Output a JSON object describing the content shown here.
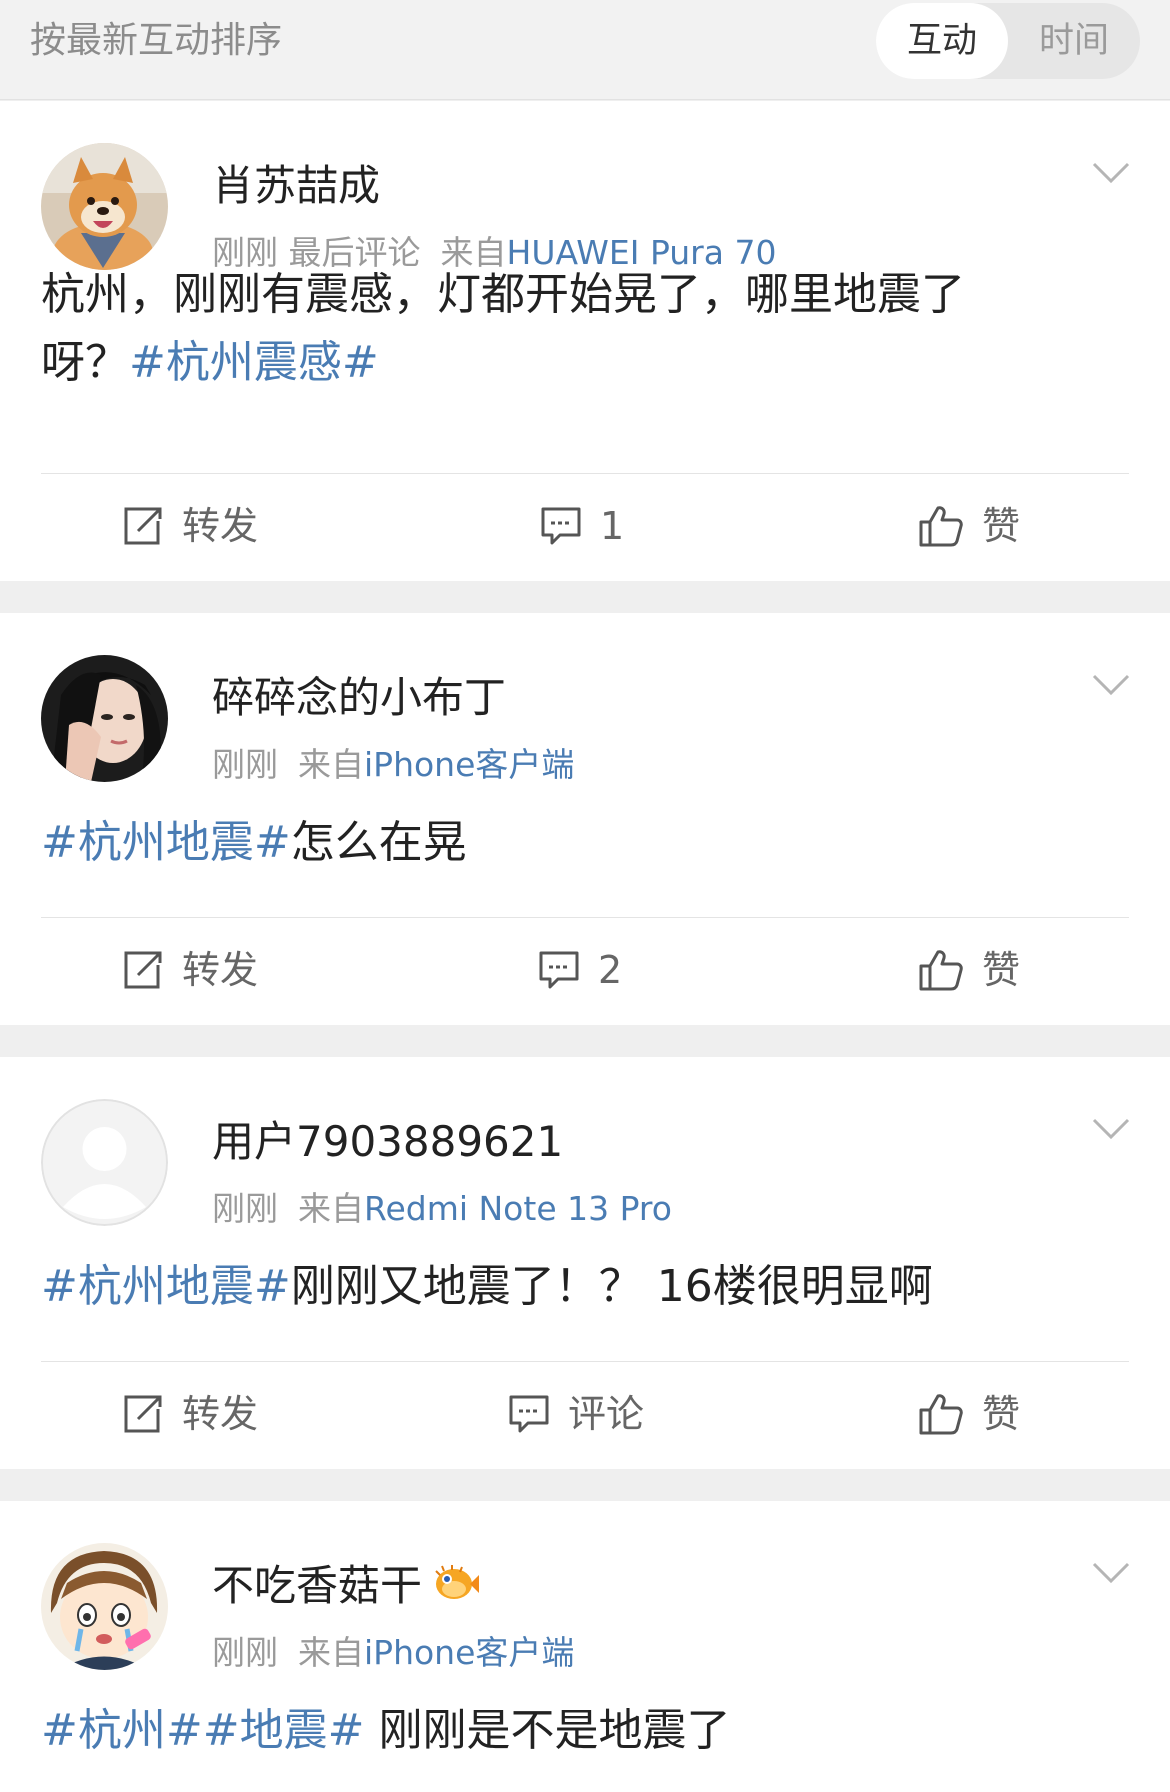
{
  "sort": {
    "title": "按最新互动排序",
    "tab_active": "互动",
    "tab_other": "时间"
  },
  "posts": [
    {
      "user": "肖苏喆成",
      "time": "刚刚",
      "extra": "最后评论",
      "from": "来自",
      "device": "HUAWEI Pura 70",
      "text_line1": "杭州，刚刚有震感，灯都开始晃了，哪里地震了",
      "text_line2": "呀？",
      "tag_end": "#杭州震感#",
      "avatar": "shiba-dog-avatar",
      "actions": {
        "repost": "转发",
        "comment": "1",
        "like": "赞"
      }
    },
    {
      "user": "碎碎念的小布丁",
      "time": "刚刚",
      "from": "来自",
      "device": "iPhone客户端",
      "tag": "#杭州地震#",
      "text": "怎么在晃",
      "avatar": "girl-photo-avatar",
      "actions": {
        "repost": "转发",
        "comment": "2",
        "like": "赞"
      }
    },
    {
      "user": "用户7903889621",
      "time": "刚刚",
      "from": "来自",
      "device": "Redmi Note 13 Pro",
      "tag": "#杭州地震#",
      "text": "刚刚又地震了！？ 16楼很明显啊",
      "avatar": "default-user-avatar",
      "actions": {
        "repost": "转发",
        "comment": "评论",
        "like": "赞"
      }
    },
    {
      "user": "不吃香菇干",
      "time": "刚刚",
      "from": "来自",
      "device": "iPhone客户端",
      "tag1": "#杭州#",
      "tag2": "#地震#",
      "text": " 刚刚是不是地震了",
      "avatar": "cartoon-crying-avatar",
      "badge": "pufferfish-emoji-icon"
    }
  ],
  "colors": {
    "link": "#4a7cb3",
    "text": "#222222",
    "meta": "#9a9a9a"
  }
}
